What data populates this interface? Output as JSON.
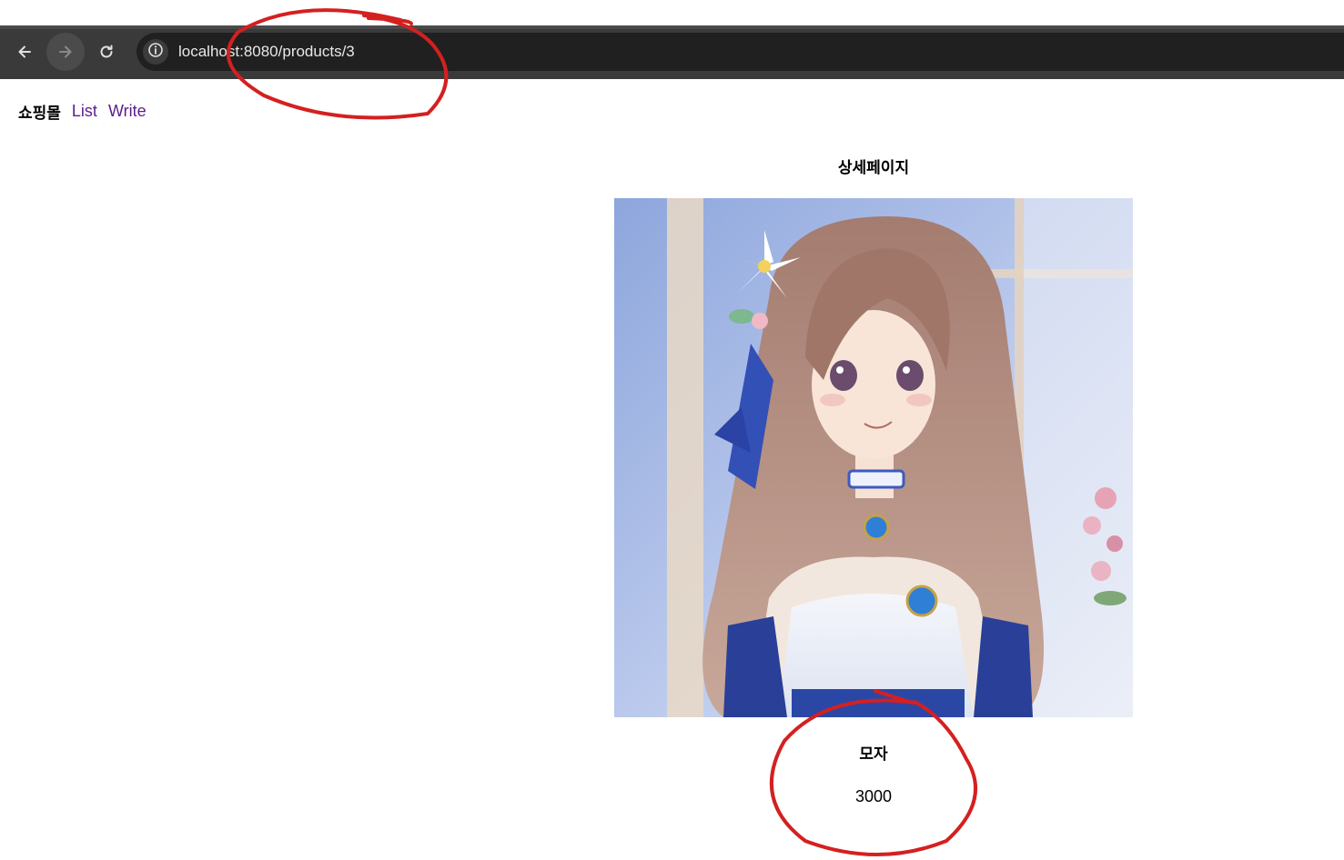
{
  "browser": {
    "url": "localhost:8080/products/3",
    "icons": {
      "back": "arrow-left-icon",
      "forward": "arrow-right-icon",
      "reload": "reload-icon",
      "site_info": "info-icon"
    }
  },
  "nav": {
    "brand": "쇼핑몰",
    "links": [
      {
        "label": "List"
      },
      {
        "label": "Write"
      }
    ]
  },
  "main": {
    "title": "상세페이지",
    "product": {
      "image": "anime-girl-watercolor-illustration",
      "name": "모자",
      "price": "3000"
    }
  },
  "colors": {
    "toolbar": "#3a3a3a",
    "omnibox": "#202020",
    "link": "#5a1e8c",
    "annotation": "#d42020"
  }
}
